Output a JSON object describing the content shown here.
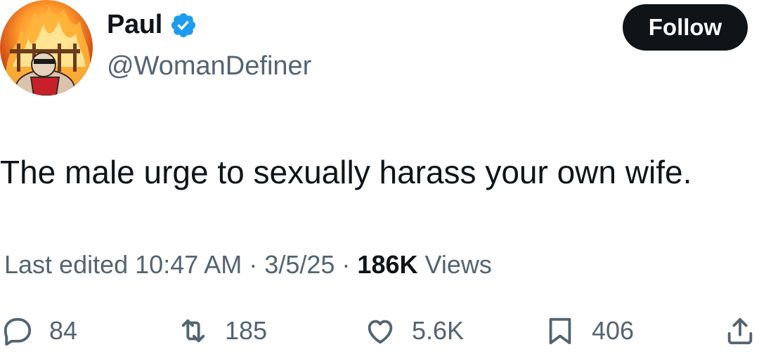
{
  "author": {
    "name": "Paul",
    "handle": "@WomanDefiner",
    "verified_color": "#1d9bf0"
  },
  "follow_label": "Follow",
  "tweet": {
    "text": "The male urge to sexually harass your own wife."
  },
  "meta": {
    "edited_prefix": "Last edited",
    "time": "10:47 AM",
    "separator": "·",
    "date": "3/5/25",
    "views_count": "186K",
    "views_label": "Views"
  },
  "actions": {
    "replies": "84",
    "reposts": "185",
    "likes": "5.6K",
    "bookmarks": "406"
  },
  "icons": [
    "reply-icon",
    "repost-icon",
    "like-icon",
    "bookmark-icon",
    "share-icon",
    "verified-badge-icon"
  ]
}
